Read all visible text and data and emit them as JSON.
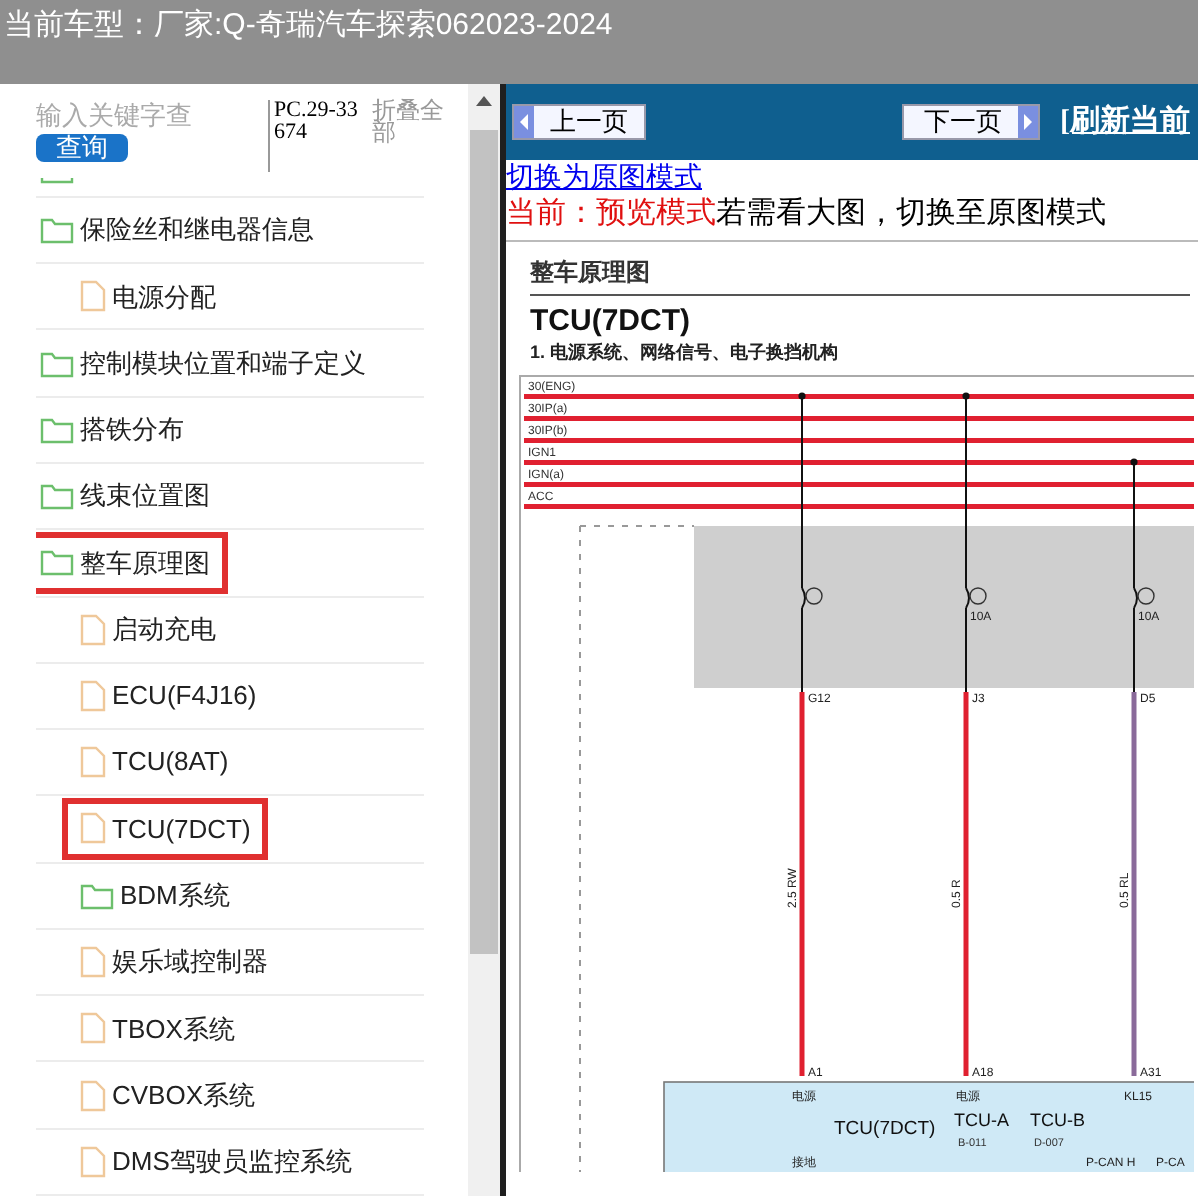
{
  "title_bar": {
    "label": "当前车型：",
    "model": "厂家:Q-奇瑞汽车探索062023-2024"
  },
  "sidebar": {
    "search": {
      "placeholder": "输入关键字查",
      "button": "查询"
    },
    "code": "PC.29-33674",
    "collapse_all": "折叠全部",
    "tree": [
      {
        "kind": "folder",
        "highlighted": false
      },
      {
        "kind": "folder",
        "label": "保险丝和继电器信息",
        "highlighted": false,
        "children": [
          {
            "kind": "file",
            "label": "电源分配",
            "highlighted": false
          }
        ]
      },
      {
        "kind": "folder",
        "label": "控制模块位置和端子定义",
        "highlighted": false
      },
      {
        "kind": "folder",
        "label": "搭铁分布",
        "highlighted": false
      },
      {
        "kind": "folder",
        "label": "线束位置图",
        "highlighted": false
      },
      {
        "kind": "folder",
        "label": "整车原理图",
        "highlighted": true,
        "children": [
          {
            "kind": "file",
            "label": "启动充电",
            "highlighted": false
          },
          {
            "kind": "file",
            "label": "ECU(F4J16)",
            "highlighted": false
          },
          {
            "kind": "file",
            "label": "TCU(8AT)",
            "highlighted": false
          },
          {
            "kind": "file",
            "label": "TCU(7DCT)",
            "highlighted": true
          },
          {
            "kind": "folder",
            "label": "BDM系统",
            "highlighted": false
          },
          {
            "kind": "file",
            "label": "娱乐域控制器",
            "highlighted": false
          },
          {
            "kind": "file",
            "label": "TBOX系统",
            "highlighted": false
          },
          {
            "kind": "file",
            "label": "CVBOX系统",
            "highlighted": false
          },
          {
            "kind": "file",
            "label": "DMS驾驶员监控系统",
            "highlighted": false
          }
        ]
      }
    ]
  },
  "toolbar": {
    "prev": "上一页",
    "next": "下一页",
    "refresh": "[刷新当前"
  },
  "mode": {
    "switch_link": "切换为原图模式",
    "current": "当前：预览模式",
    "hint": "若需看大图，切换至原图模式"
  },
  "document": {
    "section": "整车原理图",
    "title": "TCU(7DCT)",
    "subtitle": "1. 电源系统、网络信号、电子换挡机构",
    "buses": [
      "30(ENG)",
      "30IP(a)",
      "30IP(b)",
      "IGN1",
      "IGN(a)",
      "ACC"
    ],
    "circuits": [
      {
        "color": "#e02030",
        "pin_top": "G12",
        "wire": "2.5 RW",
        "pin_bottom": "A1",
        "terminal": "电源"
      },
      {
        "color": "#e02030",
        "fuse": "10A",
        "pin_top": "J3",
        "wire": "0.5 R",
        "pin_bottom": "A18",
        "terminal": "电源"
      },
      {
        "color": "#8a6a9a",
        "fuse": "10A",
        "pin_top": "D5",
        "wire": "0.5 RL",
        "pin_bottom": "A31",
        "terminal": "KL15"
      }
    ],
    "module": {
      "name": "TCU(7DCT)",
      "connectors": [
        {
          "name": "TCU-A",
          "code": "B-011"
        },
        {
          "name": "TCU-B",
          "code": "D-007"
        }
      ],
      "ground": "接地",
      "signals": [
        "P-CAN H",
        "P-CA"
      ]
    }
  }
}
